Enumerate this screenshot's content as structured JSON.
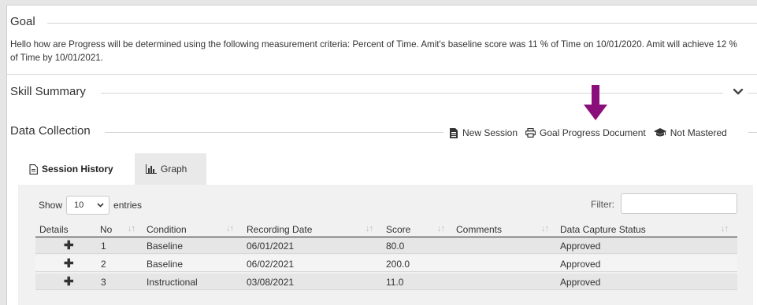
{
  "goal": {
    "title": "Goal",
    "text": "Hello how are Progress will be determined using the following measurement criteria: Percent of Time. Amit's baseline score was 11 % of Time on 10/01/2020. Amit will achieve 12 % of Time by 10/01/2021."
  },
  "skill_summary": {
    "title": "Skill Summary"
  },
  "data_collection": {
    "title": "Data Collection",
    "actions": {
      "new_session": "New Session",
      "goal_progress": "Goal Progress Document",
      "not_mastered": "Not Mastered"
    },
    "arrow_color": "#8b0f7a"
  },
  "tabs": {
    "session_history": "Session History",
    "graph": "Graph"
  },
  "table_controls": {
    "show_label": "Show",
    "entries_value": "10",
    "entries_label": "entries",
    "filter_label": "Filter:",
    "filter_value": ""
  },
  "table": {
    "headers": {
      "details": "Details",
      "no": "No",
      "condition": "Condition",
      "recording_date": "Recording Date",
      "score": "Score",
      "comments": "Comments",
      "status": "Data Capture Status"
    },
    "rows": [
      {
        "no": "1",
        "condition": "Baseline",
        "date": "06/01/2021",
        "score": "80.0",
        "comments": "",
        "status": "Approved"
      },
      {
        "no": "2",
        "condition": "Baseline",
        "date": "06/02/2021",
        "score": "200.0",
        "comments": "",
        "status": "Approved"
      },
      {
        "no": "3",
        "condition": "Instructional",
        "date": "03/08/2021",
        "score": "11.0",
        "comments": "",
        "status": "Approved"
      }
    ]
  }
}
